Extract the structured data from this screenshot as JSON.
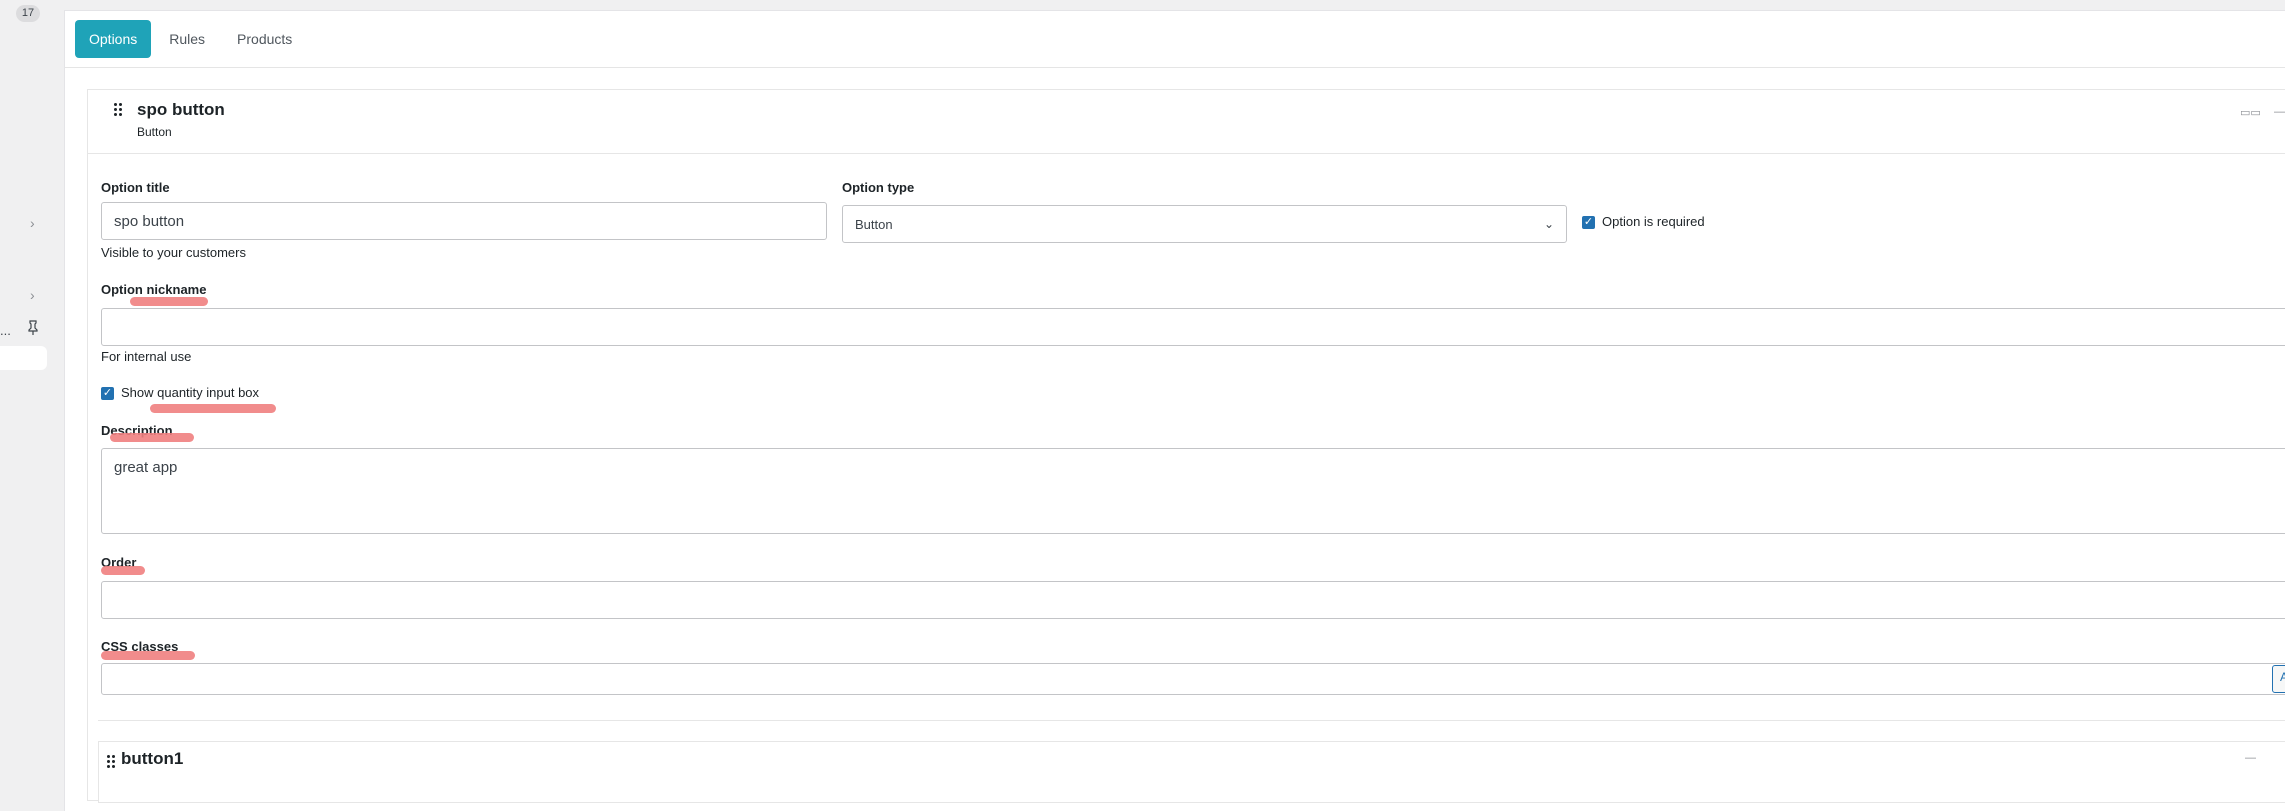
{
  "sidebar": {
    "badge": "17",
    "dots": "..."
  },
  "tabs": [
    "Options",
    "Rules",
    "Products"
  ],
  "option": {
    "title": "spo button",
    "subtitle": "Button"
  },
  "form": {
    "option_title_label": "Option title",
    "option_title_value": "spo button",
    "option_title_help": "Visible to your customers",
    "option_type_label": "Option type",
    "option_type_value": "Button",
    "required_label": "Option is required",
    "required_checked": true,
    "nickname_label": "Option nickname",
    "nickname_value": "",
    "nickname_help": "For internal use",
    "quantity_label": "Show quantity input box",
    "quantity_checked": true,
    "description_label": "Description",
    "description_value": "great app",
    "order_label": "Order",
    "order_value": "",
    "css_label": "CSS classes",
    "css_value": "",
    "css_add_button": "A"
  },
  "sub_option": {
    "title": "button1"
  },
  "colors": {
    "accent": "#1fa3b8",
    "checkbox": "#2271b1",
    "highlight": "#f08080"
  }
}
